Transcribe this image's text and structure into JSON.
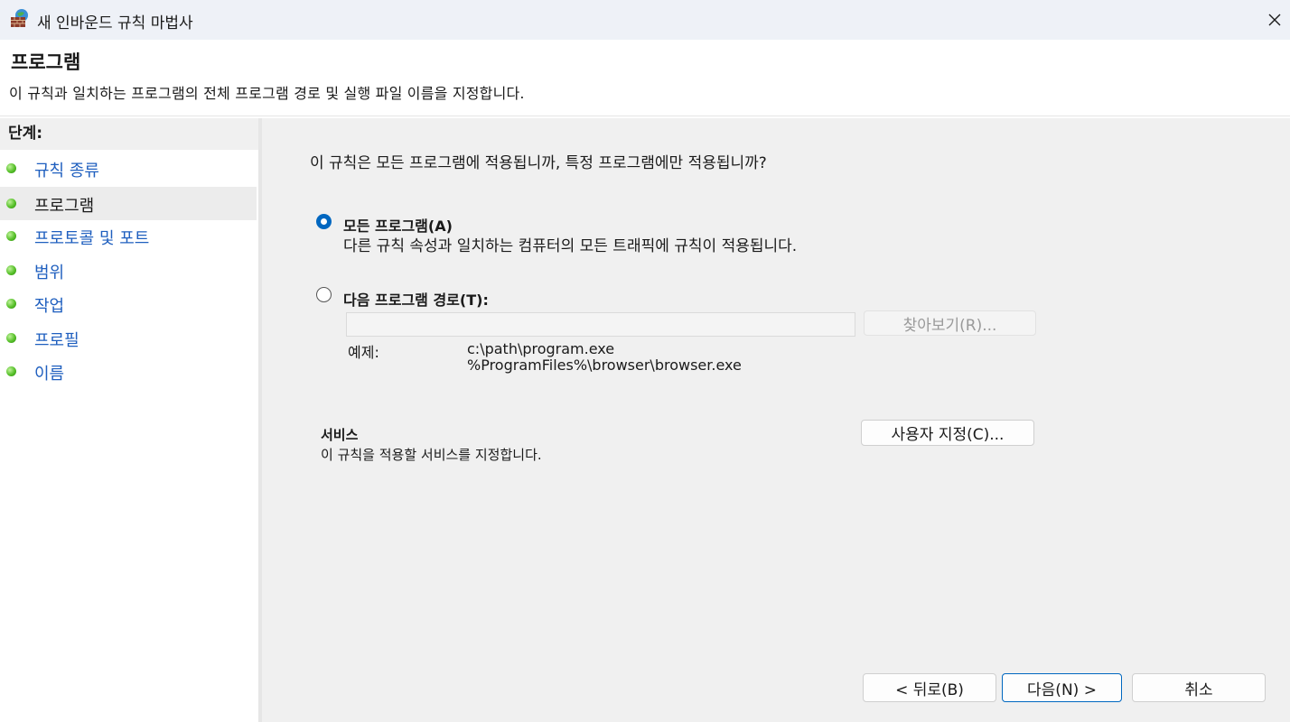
{
  "window": {
    "title": "새 인바운드 규칙 마법사",
    "icon": "firewall-globe-icon"
  },
  "header": {
    "title": "프로그램",
    "description": "이 규칙과 일치하는 프로그램의 전체 프로그램 경로 및 실행 파일 이름을 지정합니다."
  },
  "sidebar": {
    "heading": "단계:",
    "steps": [
      {
        "label": "규칙 종류"
      },
      {
        "label": "프로그램"
      },
      {
        "label": "프로토콜 및 포트"
      },
      {
        "label": "범위"
      },
      {
        "label": "작업"
      },
      {
        "label": "프로필"
      },
      {
        "label": "이름"
      }
    ],
    "current_step": "프로그램"
  },
  "main": {
    "question": "이 규칙은 모든 프로그램에 적용됩니까, 특정 프로그램에만 적용됩니까?",
    "all_programs": {
      "label": "모든 프로그램(A)",
      "description": "다른 규칙 속성과 일치하는 컴퓨터의 모든 트래픽에 규칙이 적용됩니다.",
      "selected": true
    },
    "program_path": {
      "label": "다음 프로그램 경로(T):",
      "value": "",
      "selected": false,
      "browse_label": "찾아보기(R)...",
      "example_label": "예제:",
      "example_lines": [
        "c:\\path\\program.exe",
        "%ProgramFiles%\\browser\\browser.exe"
      ]
    },
    "services": {
      "title": "서비스",
      "description": "이 규칙을 적용할 서비스를 지정합니다.",
      "customize_label": "사용자 지정(C)..."
    }
  },
  "footer": {
    "back_label": "< 뒤로(B)",
    "next_label": "다음(N) >",
    "cancel_label": "취소"
  },
  "colors": {
    "accent": "#0067c0",
    "link": "#1f5fbf",
    "panel": "#f0f0f0",
    "titlebar": "#eef1f7"
  }
}
